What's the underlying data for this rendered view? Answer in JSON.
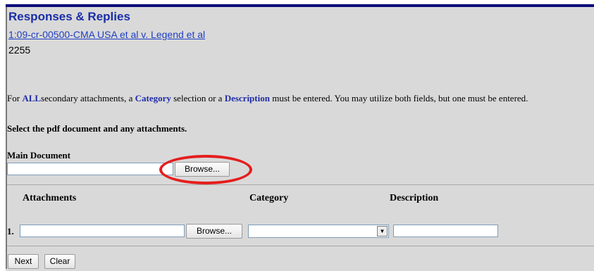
{
  "header": {
    "title": "Responses & Replies",
    "case_link": "1:09-cr-00500-CMA USA et al v. Legend et al",
    "doc_number": "2255"
  },
  "instructions": {
    "part1": "For ",
    "all": "ALL",
    "part2": "secondary attachments, a ",
    "category": "Category",
    "part3": " selection or a ",
    "description": "Description",
    "part4": " must be entered. You may utilize both fields, but one must be entered."
  },
  "select_note": "Select the pdf document and any attachments.",
  "main_document": {
    "label": "Main Document",
    "value": "",
    "browse_label": "Browse..."
  },
  "attachments": {
    "headers": {
      "attachments": "Attachments",
      "category": "Category",
      "description": "Description"
    },
    "rows": [
      {
        "number": "1.",
        "file": "",
        "browse_label": "Browse...",
        "category": "",
        "description": ""
      }
    ]
  },
  "actions": {
    "next_label": "Next",
    "clear_label": "Clear"
  },
  "colors": {
    "highlight": "#e41e1e",
    "title": "#1a2ea6",
    "panel": "#d9d9d9"
  }
}
